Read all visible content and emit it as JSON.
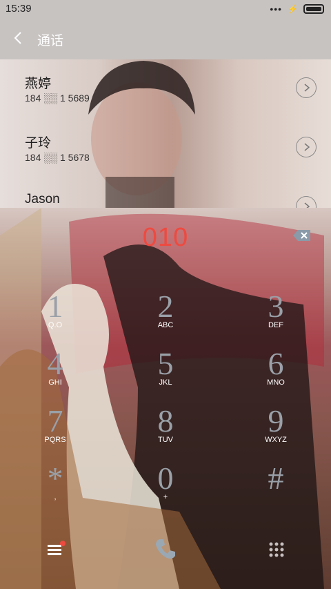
{
  "status": {
    "time": "15:39",
    "more": "•••",
    "charging": "⚡"
  },
  "app": {
    "title": "通话"
  },
  "contacts": [
    {
      "name": "燕婷",
      "number": "184 ░░ 1 5689"
    },
    {
      "name": "子玲",
      "number": "184 ░░ 1 5678"
    },
    {
      "name": "Jason",
      "number": ""
    }
  ],
  "dialer": {
    "input": "010",
    "keys": [
      {
        "digit": "1",
        "letters": "Q.O"
      },
      {
        "digit": "2",
        "letters": "ABC"
      },
      {
        "digit": "3",
        "letters": "DEF"
      },
      {
        "digit": "4",
        "letters": "GHI"
      },
      {
        "digit": "5",
        "letters": "JKL"
      },
      {
        "digit": "6",
        "letters": "MNO"
      },
      {
        "digit": "7",
        "letters": "PQRS"
      },
      {
        "digit": "8",
        "letters": "TUV"
      },
      {
        "digit": "9",
        "letters": "WXYZ"
      },
      {
        "digit": "*",
        "letters": ","
      },
      {
        "digit": "0",
        "letters": "+"
      },
      {
        "digit": "#",
        "letters": ""
      }
    ]
  },
  "colors": {
    "accent": "#ee4a40",
    "digit": "#9aa0a8"
  }
}
